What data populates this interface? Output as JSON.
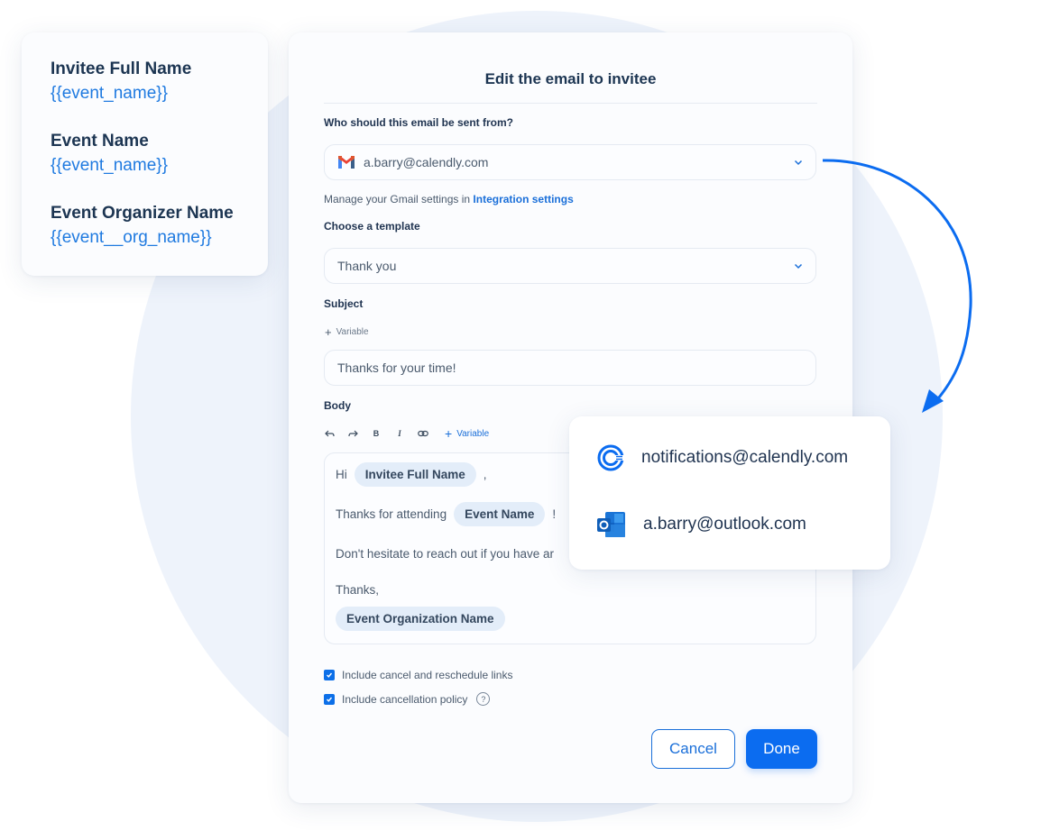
{
  "variables_card": {
    "items": [
      {
        "label": "Invitee Full Name",
        "token": "{{event_name}}"
      },
      {
        "label": "Event Name",
        "token": "{{event_name}}"
      },
      {
        "label": "Event Organizer Name",
        "token": "{{event__org_name}}"
      }
    ]
  },
  "dialog": {
    "title": "Edit the email to invitee",
    "sender": {
      "label": "Who should this email be sent from?",
      "value": "a.barry@calendly.com",
      "icon": "gmail-icon",
      "help_prefix": "Manage your Gmail settings in",
      "help_link": "Integration settings"
    },
    "template": {
      "label": "Choose a template",
      "value": "Thank you"
    },
    "subject": {
      "label": "Subject",
      "add_variable": "Variable",
      "value": "Thanks for your time!"
    },
    "body": {
      "label": "Body",
      "toolbar": {
        "undo": "undo-icon",
        "redo": "redo-icon",
        "bold": "B",
        "italic": "I",
        "link": "link-icon",
        "add_variable": "Variable"
      },
      "line1_prefix": "Hi",
      "line1_chip": "Invitee Full Name",
      "line1_suffix": ",",
      "line2_prefix": "Thanks for attending",
      "line2_chip": "Event Name",
      "line2_suffix": "!",
      "line3": "Don't hesitate to reach out if you have ar",
      "line4": "Thanks,",
      "line5_chip": "Event Organization Name"
    },
    "checkboxes": [
      {
        "label": "Include cancel and reschedule links",
        "checked": true
      },
      {
        "label": "Include cancellation policy",
        "checked": true
      }
    ],
    "help_icon": "?",
    "cancel_label": "Cancel",
    "done_label": "Done"
  },
  "sender_options": [
    {
      "email": "notifications@calendly.com",
      "icon": "calendly-icon"
    },
    {
      "email": "a.barry@outlook.com",
      "icon": "outlook-icon"
    }
  ],
  "colors": {
    "accent": "#0b6cf0",
    "link": "#1a6fd9",
    "chip_bg": "#e3edf9",
    "text_dark": "#1c3552"
  }
}
